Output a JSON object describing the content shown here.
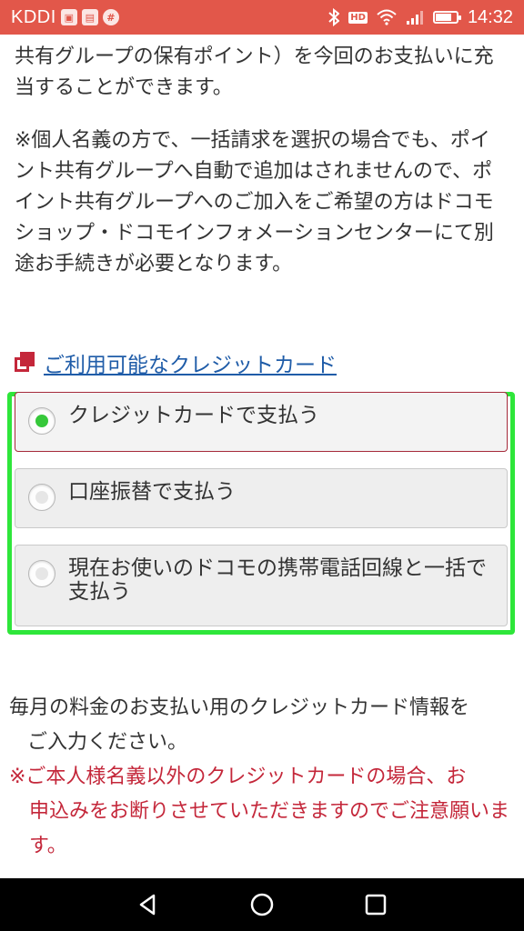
{
  "status_bar": {
    "carrier": "KDDI",
    "time": "14:32",
    "hd_label": "HD",
    "icons": [
      "notification-icon",
      "sim-icon",
      "slack-icon",
      "bluetooth-icon",
      "wifi-icon",
      "signal-icon",
      "battery-icon"
    ]
  },
  "content": {
    "para1": "共有グループの保有ポイント）を今回のお支払いに充当することができます。",
    "para2": "※個人名義の方で、一括請求を選択の場合でも、ポイント共有グループへ自動で追加はされませんので、ポイント共有グループへのご加入をご希望の方はドコモショップ・ドコモインフォメーションセンターにて別途お手続きが必要となります。",
    "credit_link": "ご利用可能なクレジットカード",
    "payment_options": [
      {
        "label": "クレジットカードで支払う",
        "selected": true
      },
      {
        "label": "口座振替で支払う",
        "selected": false
      },
      {
        "label": "現在お使いのドコモの携帯電話回線と一括で支払う",
        "selected": false
      }
    ],
    "para3_line1": "毎月の料金のお支払い用のクレジットカード情報を",
    "para3_line2": "ご入力ください。",
    "warning_line1": "※ご本人様名義以外のクレジットカードの場合、お",
    "warning_line2": "申込みをお断りさせていただきますのでご注意願います。"
  },
  "colors": {
    "status_bar": "#e2574a",
    "selected_radio": "#36c83a",
    "highlight_border": "#2ee63a",
    "link": "#1f5ca8",
    "warning": "#c4273a"
  },
  "nav_bar": {
    "icons": [
      "back-icon",
      "home-icon",
      "recents-icon"
    ]
  }
}
